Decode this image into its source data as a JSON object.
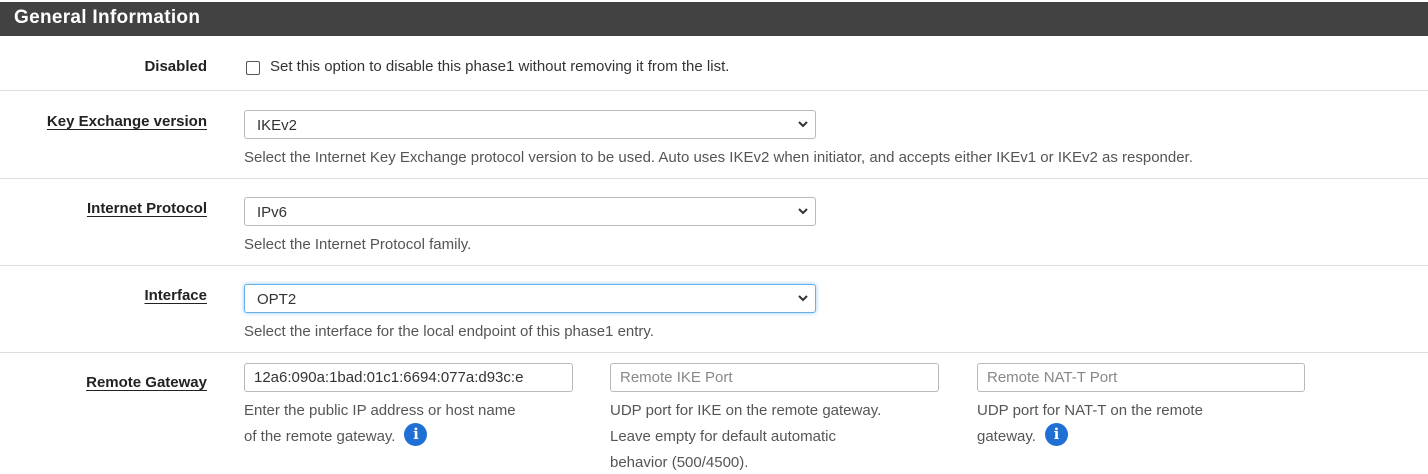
{
  "panel": {
    "title": "General Information"
  },
  "disabled": {
    "label": "Disabled",
    "checked": false,
    "text": "Set this option to disable this phase1 without removing it from the list."
  },
  "key_exchange": {
    "label": "Key Exchange version",
    "value": "IKEv2",
    "help": "Select the Internet Key Exchange protocol version to be used. Auto uses IKEv2 when initiator, and accepts either IKEv1 or IKEv2 as responder."
  },
  "internet_protocol": {
    "label": "Internet Protocol",
    "value": "IPv6",
    "help": "Select the Internet Protocol family."
  },
  "interface": {
    "label": "Interface",
    "value": "OPT2",
    "help": "Select the interface for the local endpoint of this phase1 entry."
  },
  "remote_gateway": {
    "label": "Remote Gateway",
    "address": {
      "value": "12a6:090a:1bad:01c1:6694:077a:d93c:e",
      "help_line1": "Enter the public IP address or host name",
      "help_line2": "of the remote gateway."
    },
    "ike_port": {
      "placeholder": "Remote IKE Port",
      "help_line1": "UDP port for IKE on the remote gateway.",
      "help_line2": "Leave empty for default automatic",
      "help_line3": "behavior (500/4500)."
    },
    "natt_port": {
      "placeholder": "Remote NAT-T Port",
      "help_line1": "UDP port for NAT-T on the remote",
      "help_line2": "gateway."
    }
  },
  "icons": {
    "info": "info-icon",
    "select_arrow": "chevron-down-icon",
    "info_color": "#1f6fd4",
    "header_bg": "#424242",
    "focus_color": "#66afe9"
  }
}
